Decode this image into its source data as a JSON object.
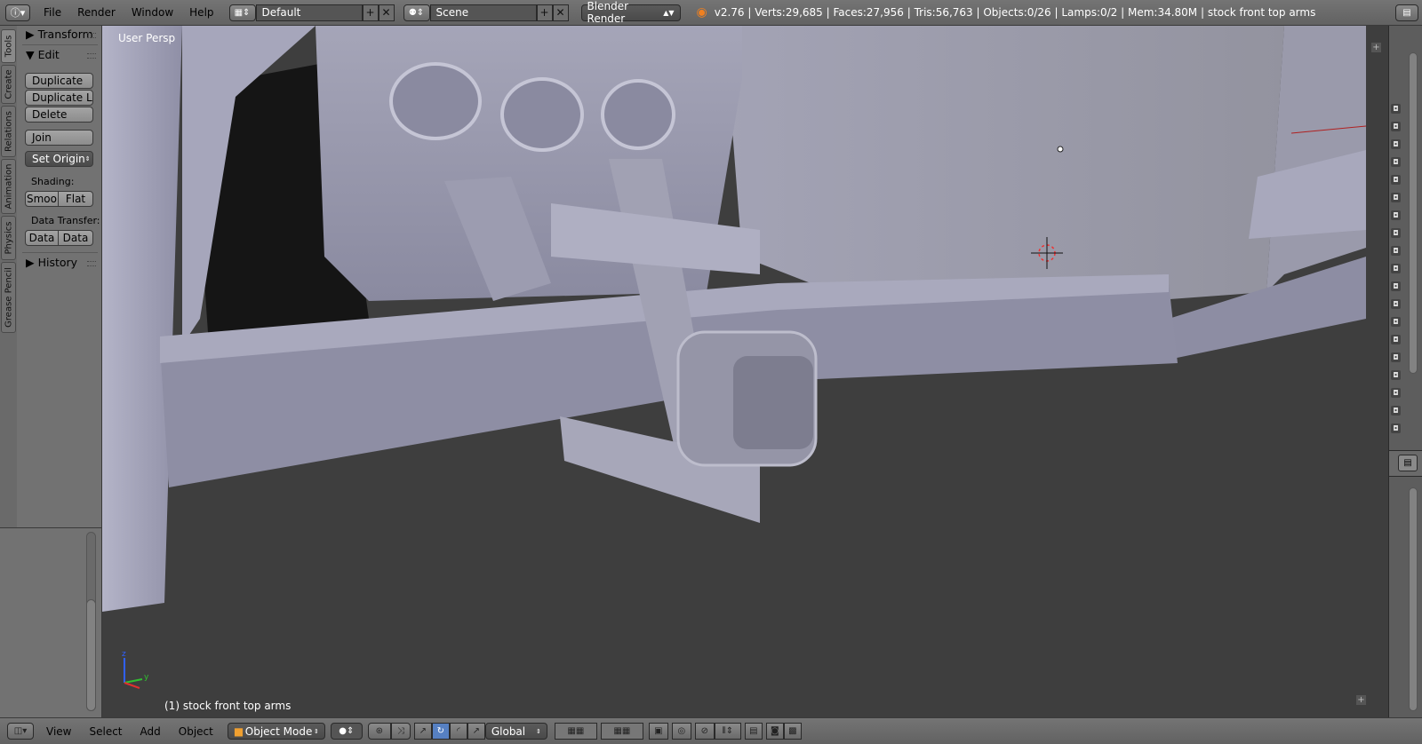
{
  "header": {
    "info_icon": "info-icon",
    "menus": [
      "File",
      "Render",
      "Window",
      "Help"
    ],
    "screen_layout": "Default",
    "scene": "Scene",
    "render_engine": "Blender Render",
    "stats": "v2.76 | Verts:29,685 | Faces:27,956 | Tris:56,763 | Objects:0/26 | Lamps:0/2 | Mem:34.80M | stock front top arms"
  },
  "side_tabs": [
    "Tools",
    "Create",
    "Relations",
    "Animation",
    "Physics",
    "Grease Pencil"
  ],
  "tools": {
    "transform_header": "Transform",
    "edit_header": "Edit",
    "duplicate": "Duplicate",
    "duplicate_linked": "Duplicate L...",
    "delete": "Delete",
    "join": "Join",
    "set_origin": "Set Origin",
    "shading_label": "Shading:",
    "smooth": "Smoo",
    "flat": "Flat",
    "data_transfer_label": "Data Transfer:",
    "data1": "Data",
    "data2": "Data",
    "history_header": "History"
  },
  "viewport": {
    "view_label": "User Persp",
    "object_label": "(1) stock front top arms",
    "axis_z": "z",
    "axis_y": "y"
  },
  "footer": {
    "menus": [
      "View",
      "Select",
      "Add",
      "Object"
    ],
    "mode": "Object Mode",
    "orientation": "Global"
  },
  "colors": {
    "header_bg": "#6a6a6a",
    "viewport_bg": "#3e3e3e",
    "mesh": "#9a9aae"
  }
}
